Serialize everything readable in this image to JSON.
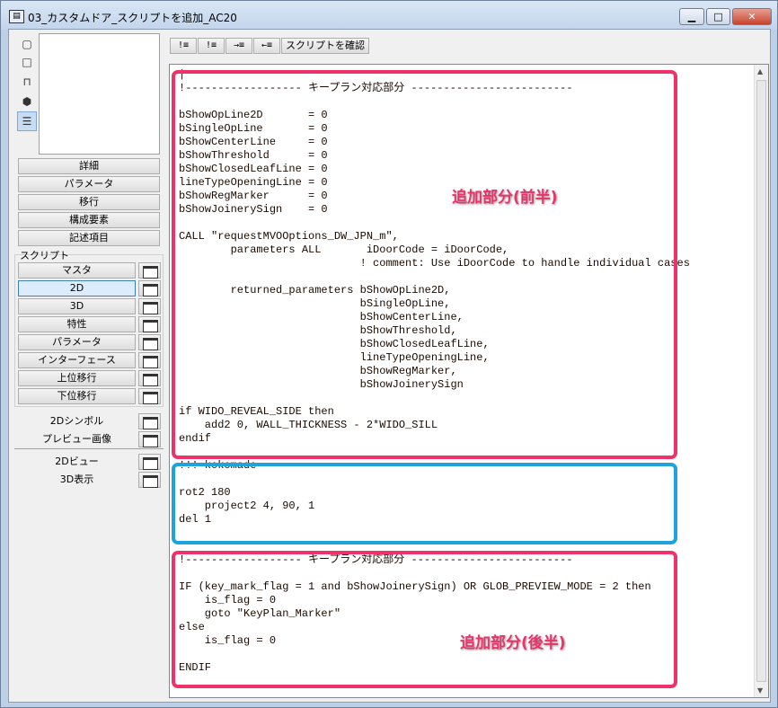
{
  "window": {
    "title": "03_カスタムドア_スクリプトを追加_AC20",
    "minimize": "▁",
    "maximize": "□",
    "close": "✕"
  },
  "sidebar": {
    "buttons": [
      "詳細",
      "パラメータ",
      "移行",
      "構成要素",
      "記述項目"
    ],
    "script_group_label": "スクリプト",
    "scripts": [
      "マスタ",
      "2D",
      "3D",
      "特性",
      "パラメータ",
      "インターフェース",
      "上位移行",
      "下位移行"
    ],
    "selected_script": "2D",
    "extras": [
      "2Dシンボル",
      "プレビュー画像"
    ],
    "views": [
      "2Dビュー",
      "3D表示"
    ]
  },
  "toolbar": {
    "b1": "!≡",
    "b2": "!≡",
    "b3": "→≡",
    "b4": "←≡",
    "check_script": "スクリプトを確認"
  },
  "code": [
    "|",
    "!------------------ キープラン対応部分 -------------------------",
    "",
    "bShowOpLine2D       = 0",
    "bSingleOpLine       = 0",
    "bShowCenterLine     = 0",
    "bShowThreshold      = 0",
    "bShowClosedLeafLine = 0",
    "lineTypeOpeningLine = 0",
    "bShowRegMarker      = 0",
    "bShowJoinerySign    = 0",
    "",
    "CALL \"requestMVOOptions_DW_JPN_m\",",
    "        parameters ALL       iDoorCode = iDoorCode,",
    "                            ! comment: Use iDoorCode to handle individual cases",
    "",
    "        returned_parameters bShowOpLine2D,",
    "                            bSingleOpLine,",
    "                            bShowCenterLine,",
    "                            bShowThreshold,",
    "                            bShowClosedLeafLine,",
    "                            lineTypeOpeningLine,",
    "                            bShowRegMarker,",
    "                            bShowJoinerySign",
    "",
    "if WIDO_REVEAL_SIDE then",
    "    add2 0, WALL_THICKNESS - 2*WIDO_SILL",
    "endif",
    "",
    "!!! kokomade",
    "",
    "rot2 180",
    "    project2 4, 90, 1",
    "del 1",
    "",
    "",
    "!------------------ キープラン対応部分 -------------------------",
    "",
    "IF (key_mark_flag = 1 and bShowJoinerySign) OR GLOB_PREVIEW_MODE = 2 then",
    "    is_flag = 0",
    "    goto \"KeyPlan_Marker\"",
    "else",
    "    is_flag = 0",
    "",
    "ENDIF"
  ],
  "annotations": {
    "first_half": "追加部分(前半)",
    "second_half": "追加部分(後半)",
    "red": "#f0326a",
    "blue": "#1ea3dc"
  }
}
